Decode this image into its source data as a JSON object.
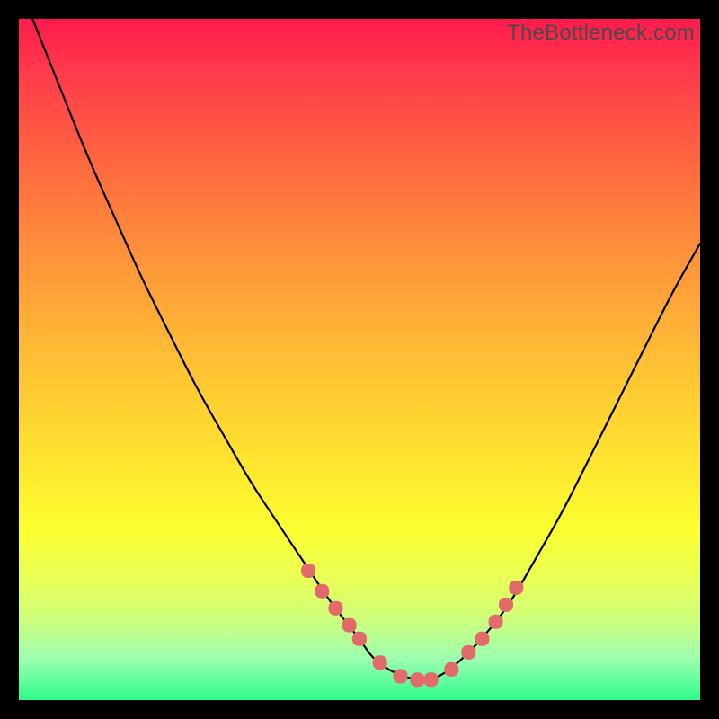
{
  "watermark": "TheBottleneck.com",
  "colors": {
    "gradient_top": "#ff1a4d",
    "gradient_bottom": "#2dfc8a",
    "curve": "#000000",
    "markers": "#e26a6a",
    "frame": "#000000"
  },
  "chart_data": {
    "type": "line",
    "title": "",
    "xlabel": "",
    "ylabel": "",
    "xlim": [
      0,
      100
    ],
    "ylim": [
      0,
      100
    ],
    "curve": {
      "x": [
        2,
        6,
        10,
        14,
        18,
        22,
        26,
        30,
        34,
        38,
        42,
        46,
        50,
        52,
        55,
        58,
        61,
        64,
        68,
        72,
        76,
        80,
        84,
        88,
        92,
        96,
        100
      ],
      "y": [
        100,
        90,
        80,
        71,
        62,
        54,
        46,
        39,
        32,
        26,
        20,
        14,
        9,
        6,
        4,
        3,
        3,
        5,
        9,
        14,
        21,
        28,
        36,
        44,
        52,
        60,
        67
      ]
    },
    "markers": {
      "x": [
        42.5,
        44.5,
        46.5,
        48.5,
        50.0,
        53.0,
        56.0,
        58.5,
        60.5,
        63.5,
        66.0,
        68.0,
        70.0,
        71.5,
        73.0
      ],
      "y": [
        19.0,
        16.0,
        13.5,
        11.0,
        9.0,
        5.5,
        3.5,
        3.0,
        3.0,
        4.5,
        7.0,
        9.0,
        11.5,
        14.0,
        16.5
      ]
    }
  }
}
